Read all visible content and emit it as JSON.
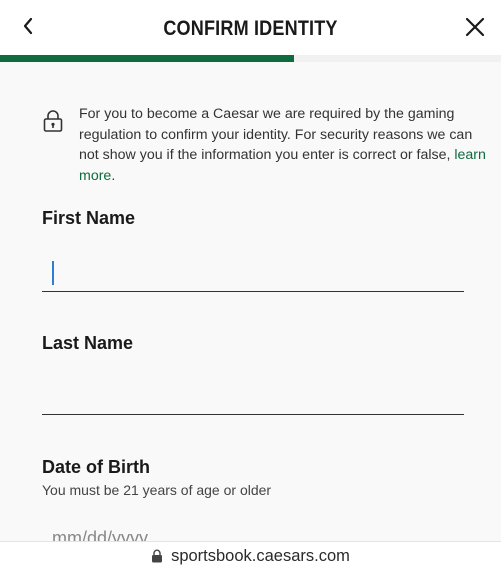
{
  "header": {
    "title": "CONFIRM IDENTITY",
    "back_icon": "chevron-left-icon",
    "close_icon": "close-icon"
  },
  "progress": {
    "value_percent": 58.7,
    "fill_color": "#0f6b3e",
    "track_color": "#f1f1f1"
  },
  "notice": {
    "icon": "lock-icon",
    "text": "For you to become a Caesar we are required by the gaming regulation to confirm your identity. For security reasons we can not show you if the information you enter is correct or false, ",
    "link_label": "learn more",
    "suffix": "."
  },
  "form": {
    "first_name": {
      "label": "First Name",
      "value": ""
    },
    "last_name": {
      "label": "Last Name",
      "value": ""
    },
    "dob": {
      "label": "Date of Birth",
      "hint": "You must be 21 years of age or older",
      "placeholder": "mm/dd/yyyy"
    }
  },
  "browser": {
    "url": "sportsbook.caesars.com",
    "lock_icon": "lock-icon"
  },
  "colors": {
    "accent_green": "#0f6b3e",
    "caret_blue": "#2d7fd1"
  }
}
